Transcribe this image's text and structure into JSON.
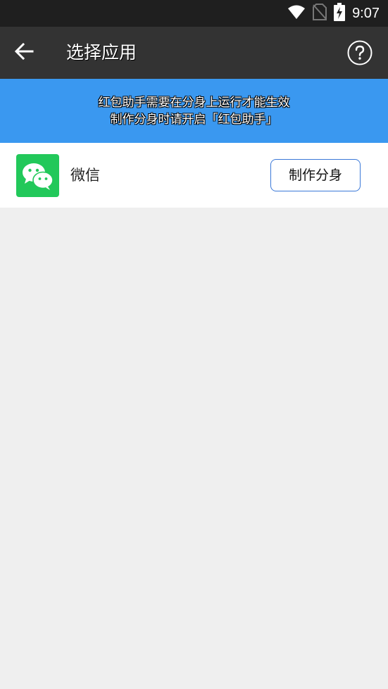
{
  "status_bar": {
    "time": "9:07",
    "icons": [
      "wifi-icon",
      "no-sim-icon",
      "battery-charging-icon"
    ]
  },
  "app_bar": {
    "back_icon": "arrow-back-icon",
    "title": "选择应用",
    "help_icon": "help-circle-icon"
  },
  "banner": {
    "line1": "红包助手需要在分身上运行才能生效",
    "line2": "制作分身时请开启「红包助手」",
    "background": "#3a98f0"
  },
  "apps": [
    {
      "name": "微信",
      "icon": "wechat-icon",
      "icon_color": "#22c85a",
      "action_label": "制作分身"
    }
  ],
  "colors": {
    "status_bar": "#1f1f1f",
    "app_bar": "#333333",
    "accent_border": "#3a78d8",
    "page_background": "#efefef"
  }
}
